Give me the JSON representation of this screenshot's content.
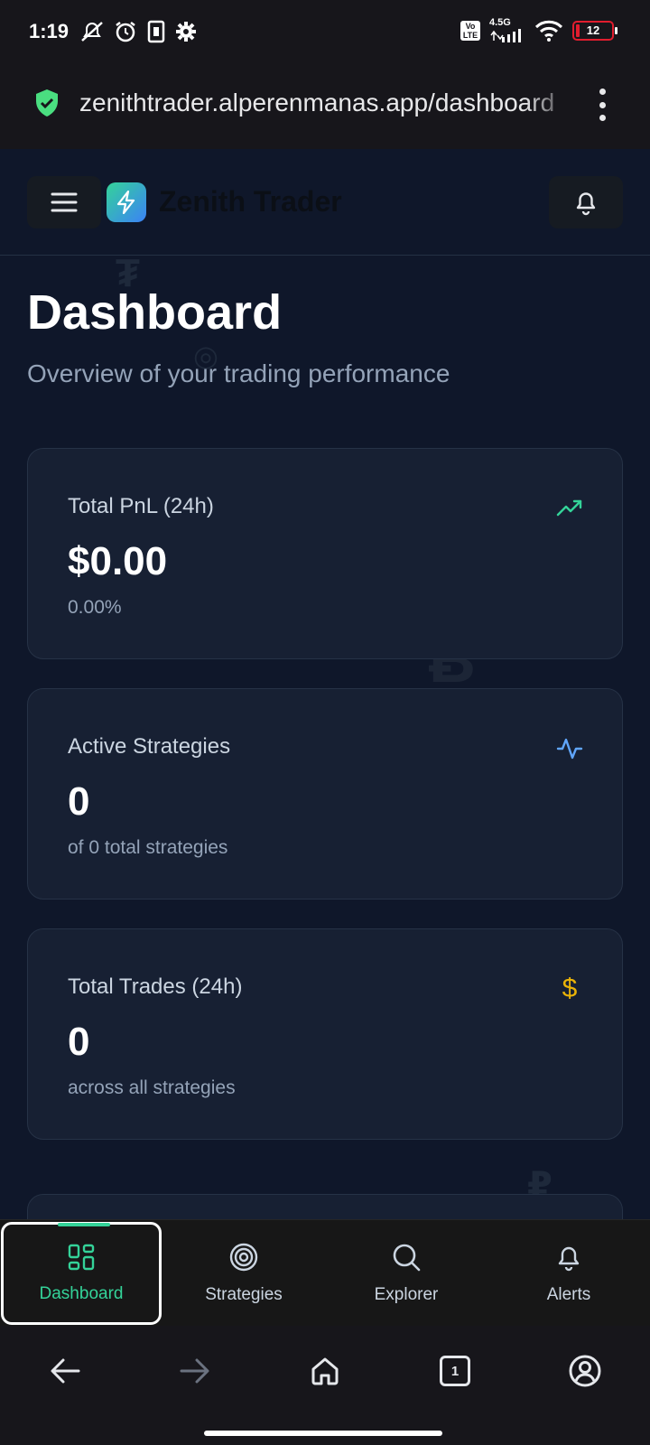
{
  "status_bar": {
    "time": "1:19",
    "network": "4.5G",
    "volte": "Vo LTE",
    "battery": "12"
  },
  "browser": {
    "url": "zenithtrader.alperenmanas.app/dashboard",
    "tab_count": "1"
  },
  "header": {
    "brand": "Zenith Trader"
  },
  "page": {
    "title": "Dashboard",
    "subtitle": "Overview of your trading performance"
  },
  "cards": [
    {
      "title": "Total PnL (24h)",
      "value": "$0.00",
      "sub": "0.00%",
      "icon": "trending-up-icon"
    },
    {
      "title": "Active Strategies",
      "value": "0",
      "sub": "of 0 total strategies",
      "icon": "activity-icon"
    },
    {
      "title": "Total Trades (24h)",
      "value": "0",
      "sub": "across all strategies",
      "icon": "dollar-icon",
      "icon_glyph": "$"
    }
  ],
  "bottom_nav": [
    {
      "label": "Dashboard",
      "icon": "grid-icon",
      "active": true
    },
    {
      "label": "Strategies",
      "icon": "target-icon",
      "active": false
    },
    {
      "label": "Explorer",
      "icon": "search-icon",
      "active": false
    },
    {
      "label": "Alerts",
      "icon": "bell-icon",
      "active": false
    }
  ],
  "colors": {
    "accent_green": "#34d399",
    "accent_blue": "#60a5fa",
    "accent_yellow": "#eab308",
    "background": "#0f172a",
    "card": "#172033"
  }
}
